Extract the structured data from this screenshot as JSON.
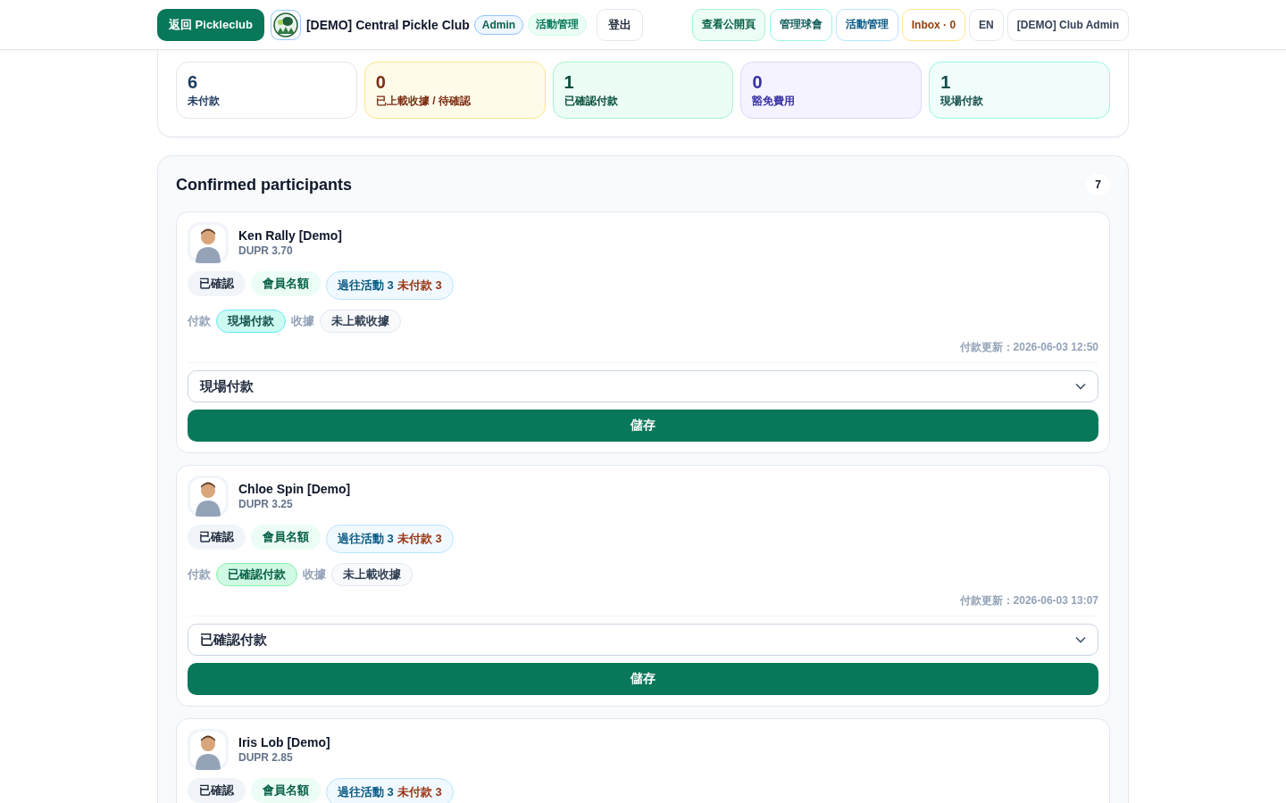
{
  "header": {
    "back_button": "返回 Pickleclub",
    "club_name": "[DEMO] Central Pickle Club",
    "badges": [
      {
        "kind": "role",
        "text": "Admin"
      },
      {
        "kind": "section",
        "text": "活動管理"
      }
    ],
    "logout": "登出",
    "nav": [
      {
        "kind": "public",
        "text": "查看公開頁"
      },
      {
        "kind": "club",
        "text": "管理球會"
      },
      {
        "kind": "events",
        "text": "活動管理"
      },
      {
        "kind": "inbox",
        "text": "Inbox · 0"
      },
      {
        "kind": "plain",
        "text": "EN"
      },
      {
        "kind": "plain",
        "text": "[DEMO] Club Admin"
      }
    ]
  },
  "summary": [
    {
      "kind": "unpaid",
      "count": "6",
      "label": "未付款"
    },
    {
      "kind": "uploaded",
      "count": "0",
      "label": "已上載收據 / 待確認"
    },
    {
      "kind": "confirmed",
      "count": "1",
      "label": "已確認付款"
    },
    {
      "kind": "waived",
      "count": "0",
      "label": "豁免費用"
    },
    {
      "kind": "onsite",
      "count": "1",
      "label": "現場付款"
    }
  ],
  "participants": {
    "title": "Confirmed participants",
    "count": "7",
    "items": [
      {
        "name": "Ken Rally [Demo]",
        "dupr": "DUPR 3.70",
        "tags": [
          {
            "kind": "status",
            "text": "已確認"
          },
          {
            "kind": "quota",
            "text": "會員名額"
          },
          {
            "kind": "history",
            "text": "過往活動 3",
            "unpaid": "未付款 3"
          }
        ],
        "payment": {
          "label": "付款",
          "kind": "onsite",
          "status": "現場付款"
        },
        "receipt": {
          "label": "收據",
          "status": "未上載收據"
        },
        "updated": "付款更新：2026-06-03 12:50",
        "select_value": "現場付款",
        "save": "儲存"
      },
      {
        "name": "Chloe Spin [Demo]",
        "dupr": "DUPR 3.25",
        "tags": [
          {
            "kind": "status",
            "text": "已確認"
          },
          {
            "kind": "quota",
            "text": "會員名額"
          },
          {
            "kind": "history",
            "text": "過往活動 3",
            "unpaid": "未付款 3"
          }
        ],
        "payment": {
          "label": "付款",
          "kind": "confirmed",
          "status": "已確認付款"
        },
        "receipt": {
          "label": "收據",
          "status": "未上載收據"
        },
        "updated": "付款更新：2026-06-03 13:07",
        "select_value": "已確認付款",
        "save": "儲存"
      },
      {
        "name": "Iris Lob [Demo]",
        "dupr": "DUPR 2.85",
        "tags": [
          {
            "kind": "status",
            "text": "已確認"
          },
          {
            "kind": "quota",
            "text": "會員名額"
          },
          {
            "kind": "history",
            "text": "過往活動 3",
            "unpaid": "未付款 3"
          }
        ]
      }
    ]
  }
}
